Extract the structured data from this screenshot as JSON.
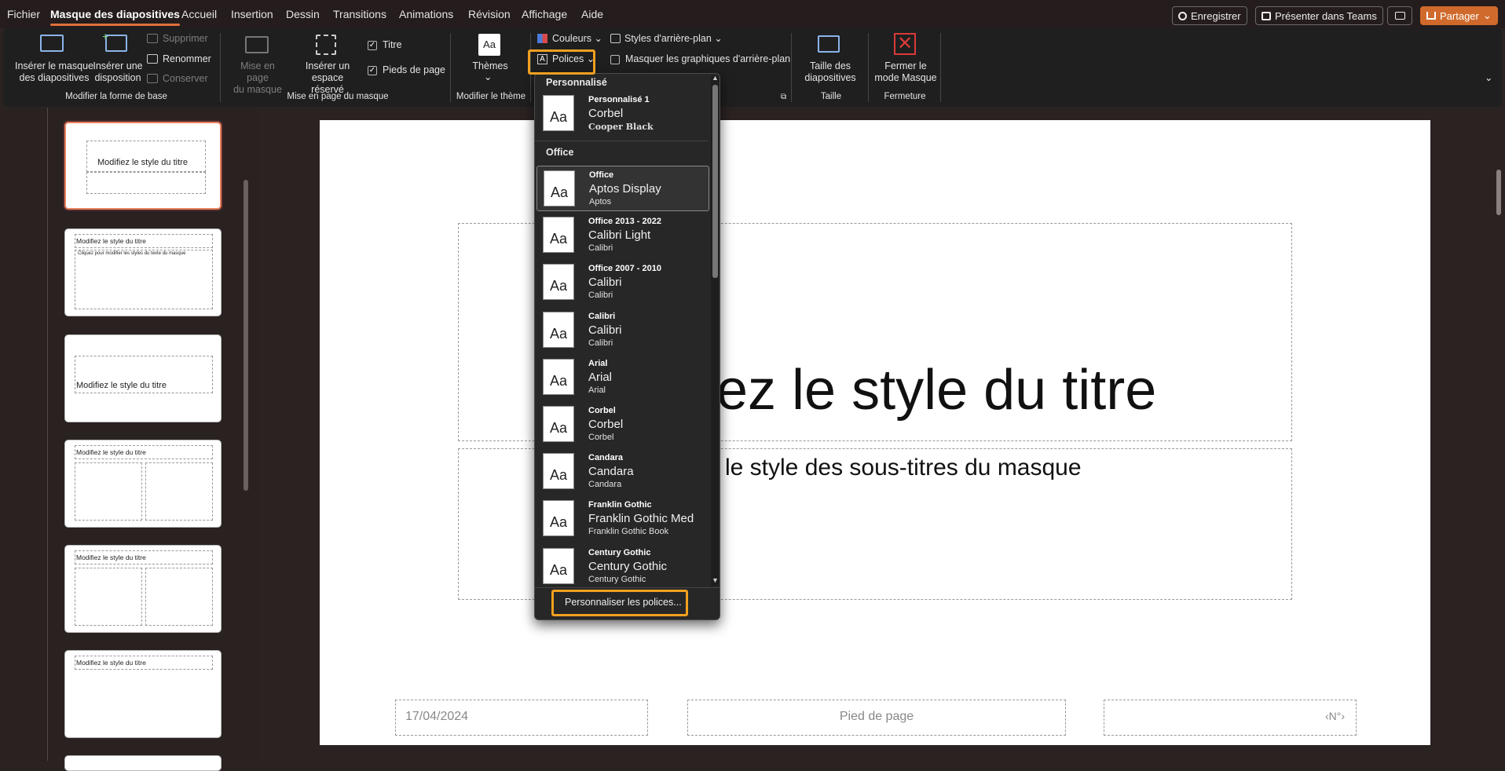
{
  "menu": {
    "items": [
      "Fichier",
      "Masque des diapositives",
      "Accueil",
      "Insertion",
      "Dessin",
      "Transitions",
      "Animations",
      "Révision",
      "Affichage",
      "Aide"
    ],
    "record": "Enregistrer",
    "teams": "Présenter dans Teams",
    "share": "Partager"
  },
  "ribbon": {
    "insert_master": "Insérer le masque\ndes diapositives",
    "insert_layout": "Insérer une\ndisposition",
    "delete": "Supprimer",
    "rename": "Renommer",
    "preserve": "Conserver",
    "group1": "Modifier la forme de base",
    "master_layout": "Mise en page\ndu masque",
    "insert_placeholder": "Insérer un espace\nréservé",
    "title_chk": "Titre",
    "footer_chk": "Pieds de page",
    "group2": "Mise en page du masque",
    "themes": "Thèmes",
    "group3": "Modifier le thème",
    "colors": "Couleurs",
    "fonts": "Polices",
    "bg_styles": "Styles d'arrière-plan",
    "hide_bg": "Masquer les graphiques d'arrière-plan",
    "slide_size": "Taille des\ndiapositives",
    "group5": "Taille",
    "close_master": "Fermer le\nmode Masque",
    "group6": "Fermeture"
  },
  "thumbnails": {
    "title": "Modifiez le style du titre",
    "body": "Cliquez pour modifier les styles du texte du masque"
  },
  "slide": {
    "title": "ez le style du titre",
    "subtitle": "le style des sous-titres du masque",
    "date": "17/04/2024",
    "footer": "Pied de page",
    "number": "‹N°›"
  },
  "fonts_dropdown": {
    "custom_header": "Personnalisé",
    "office_header": "Office",
    "custom": {
      "name": "Personnalisé 1",
      "heading": "Corbel",
      "body": "Cooper Black"
    },
    "items": [
      {
        "name": "Office",
        "heading": "Aptos Display",
        "body": "Aptos",
        "selected": true
      },
      {
        "name": "Office 2013 - 2022",
        "heading": "Calibri Light",
        "body": "Calibri"
      },
      {
        "name": "Office 2007 - 2010",
        "heading": "Calibri",
        "body": "Calibri"
      },
      {
        "name": "Calibri",
        "heading": "Calibri",
        "body": "Calibri"
      },
      {
        "name": "Arial",
        "heading": "Arial",
        "body": "Arial"
      },
      {
        "name": "Corbel",
        "heading": "Corbel",
        "body": "Corbel"
      },
      {
        "name": "Candara",
        "heading": "Candara",
        "body": "Candara"
      },
      {
        "name": "Franklin Gothic",
        "heading": "Franklin Gothic Med",
        "body": "Franklin Gothic Book"
      },
      {
        "name": "Century Gothic",
        "heading": "Century Gothic",
        "body": "Century Gothic"
      }
    ],
    "swatch": "Aa",
    "customize": "Personnaliser les polices..."
  },
  "colors": {
    "accent": "#d06a2c",
    "highlight": "#f0a020",
    "selection": "#e9805e"
  }
}
